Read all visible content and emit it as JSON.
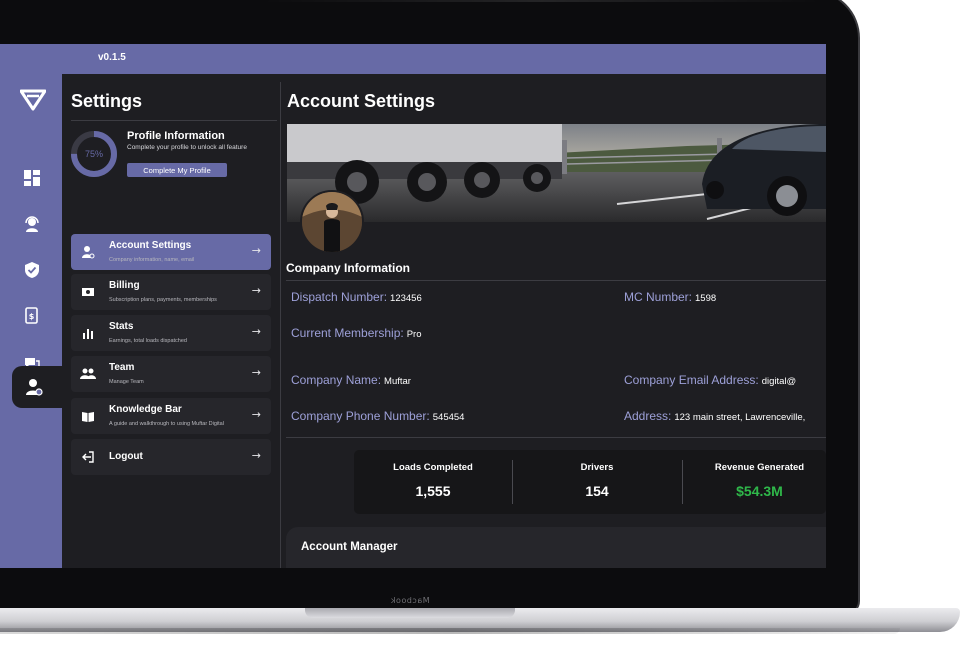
{
  "app": {
    "version": "v0.1.5"
  },
  "sidebar": {
    "icons": [
      "dashboard-icon",
      "support-agent-icon",
      "shield-check-icon",
      "document-money-icon",
      "chat-icon",
      "user-settings-icon"
    ]
  },
  "settings": {
    "title": "Settings",
    "profile": {
      "progress_text": "75%",
      "progress_fraction": 0.75,
      "title": "Profile Information",
      "subtitle": "Complete your profile to unlock all feature",
      "button_label": "Complete My Profile"
    },
    "menu": [
      {
        "label": "Account Settings",
        "sub": "Company information, name, email",
        "icon": "user-gear-icon"
      },
      {
        "label": "Billing",
        "sub": "Subscription plans, payments, memberships",
        "icon": "cash-icon"
      },
      {
        "label": "Stats",
        "sub": "Earnings, total loads dispatched",
        "icon": "bar-chart-icon"
      },
      {
        "label": "Team",
        "sub": "Manage Team",
        "icon": "team-icon"
      },
      {
        "label": "Knowledge Bar",
        "sub": "A guide and walkthrough to using Muftar Digital",
        "icon": "book-icon"
      },
      {
        "label": "Logout",
        "sub": "",
        "icon": "logout-icon"
      }
    ],
    "arrow": "→"
  },
  "account": {
    "title": "Account Settings",
    "section_title": "Company Information",
    "fields": {
      "dispatch_label": "Dispatch Number:",
      "dispatch_value": "123456",
      "mc_label": "MC Number:",
      "mc_value": "1598",
      "membership_label": "Current Membership:",
      "membership_value": "Pro",
      "company_name_label": "Company Name:",
      "company_name_value": "Muftar",
      "email_label": "Company Email Address:",
      "email_value": "digital@",
      "phone_label": "Company Phone Number:",
      "phone_value": "545454",
      "address_label": "Address:",
      "address_value": "123 main street, Lawrenceville,"
    },
    "stats": [
      {
        "label": "Loads Completed",
        "value": "1,555"
      },
      {
        "label": "Drivers",
        "value": "154"
      },
      {
        "label": "Revenue Generated",
        "value": "$54.3M"
      }
    ],
    "manager_title": "Account Manager"
  },
  "device": {
    "brand": "Macbook"
  },
  "colors": {
    "accent": "#676aa6",
    "label": "#9da0d8",
    "revenue": "#2fb84a",
    "background": "#1e1e22"
  }
}
